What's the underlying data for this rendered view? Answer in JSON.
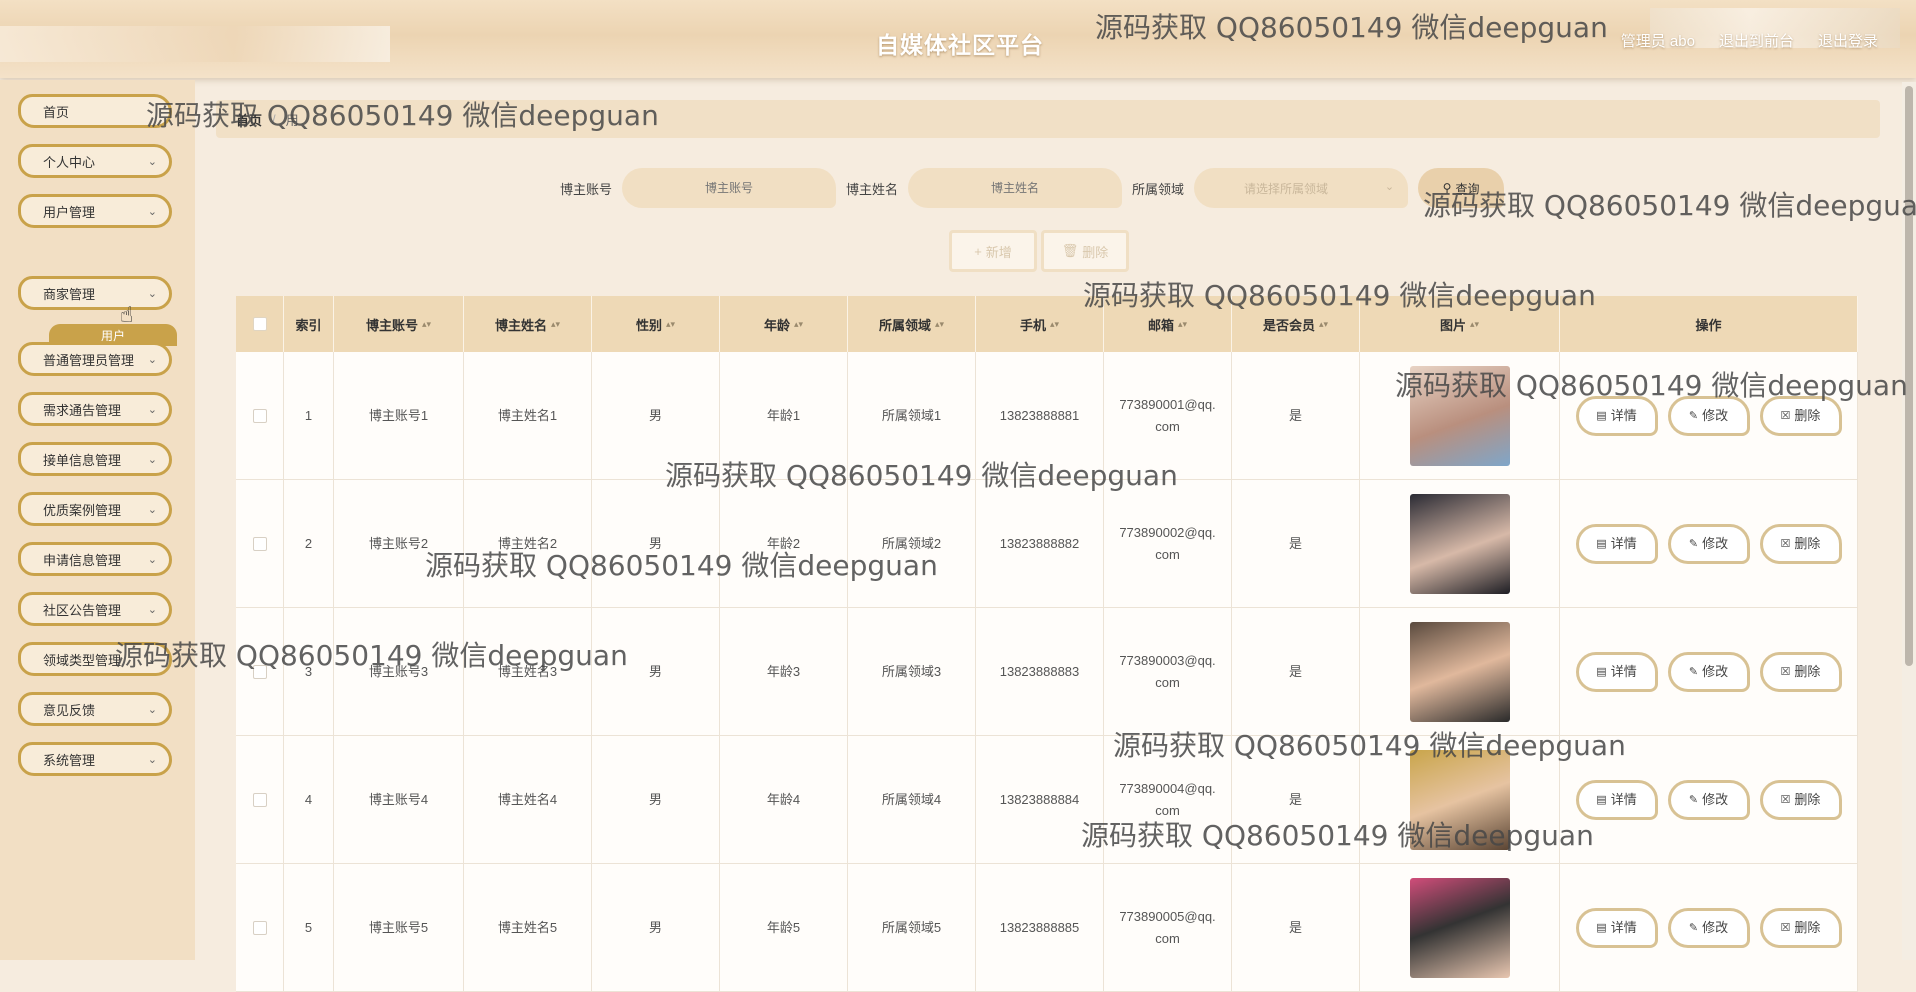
{
  "header": {
    "title": "自媒体社区平台",
    "user_label": "管理员 abo",
    "to_front": "退出到前台",
    "logout": "退出登录"
  },
  "sidebar": {
    "items": [
      {
        "label": "首页",
        "has_chevron": false
      },
      {
        "label": "个人中心",
        "has_chevron": true
      },
      {
        "label": "用户管理",
        "has_chevron": true
      },
      {
        "label": "商家管理",
        "has_chevron": true
      },
      {
        "label": "普通管理员管理",
        "has_chevron": true
      },
      {
        "label": "需求通告管理",
        "has_chevron": true
      },
      {
        "label": "接单信息管理",
        "has_chevron": true
      },
      {
        "label": "优质案例管理",
        "has_chevron": true
      },
      {
        "label": "申请信息管理",
        "has_chevron": true
      },
      {
        "label": "社区公告管理",
        "has_chevron": true
      },
      {
        "label": "领域类型管理",
        "has_chevron": true
      },
      {
        "label": "意见反馈",
        "has_chevron": true
      },
      {
        "label": "系统管理",
        "has_chevron": true
      }
    ],
    "sub_item": "用户"
  },
  "breadcrumb": {
    "home": "首页",
    "current": "用"
  },
  "search": {
    "account_label": "博主账号",
    "account_placeholder": "博主账号",
    "name_label": "博主姓名",
    "name_placeholder": "博主姓名",
    "field_label": "所属领域",
    "field_placeholder": "请选择所属领域",
    "query_button": "查询"
  },
  "actions": {
    "add": "新增",
    "delete": "删除"
  },
  "table": {
    "columns": [
      "",
      "索引",
      "博主账号",
      "博主姓名",
      "性别",
      "年龄",
      "所属领域",
      "手机",
      "邮箱",
      "是否会员",
      "图片",
      "操作"
    ],
    "rows": [
      {
        "index": "1",
        "account": "博主账号1",
        "name": "博主姓名1",
        "gender": "男",
        "age": "年龄1",
        "field": "所属领域1",
        "phone": "13823888881",
        "email": "773890001@qq.com",
        "member": "是"
      },
      {
        "index": "2",
        "account": "博主账号2",
        "name": "博主姓名2",
        "gender": "男",
        "age": "年龄2",
        "field": "所属领域2",
        "phone": "13823888882",
        "email": "773890002@qq.com",
        "member": "是"
      },
      {
        "index": "3",
        "account": "博主账号3",
        "name": "博主姓名3",
        "gender": "男",
        "age": "年龄3",
        "field": "所属领域3",
        "phone": "13823888883",
        "email": "773890003@qq.com",
        "member": "是"
      },
      {
        "index": "4",
        "account": "博主账号4",
        "name": "博主姓名4",
        "gender": "男",
        "age": "年龄4",
        "field": "所属领域4",
        "phone": "13823888884",
        "email": "773890004@qq.com",
        "member": "是"
      },
      {
        "index": "5",
        "account": "博主账号5",
        "name": "博主姓名5",
        "gender": "男",
        "age": "年龄5",
        "field": "所属领域5",
        "phone": "13823888885",
        "email": "773890005@qq.com",
        "member": "是"
      }
    ],
    "ops": {
      "detail": "详情",
      "edit": "修改",
      "remove": "删除"
    }
  },
  "watermark": "源码获取 QQ86050149 微信deepguan",
  "colors": {
    "accent": "#c9a24a",
    "header": "#eed9b6",
    "sidebar_bg": "#f2dfc4"
  }
}
